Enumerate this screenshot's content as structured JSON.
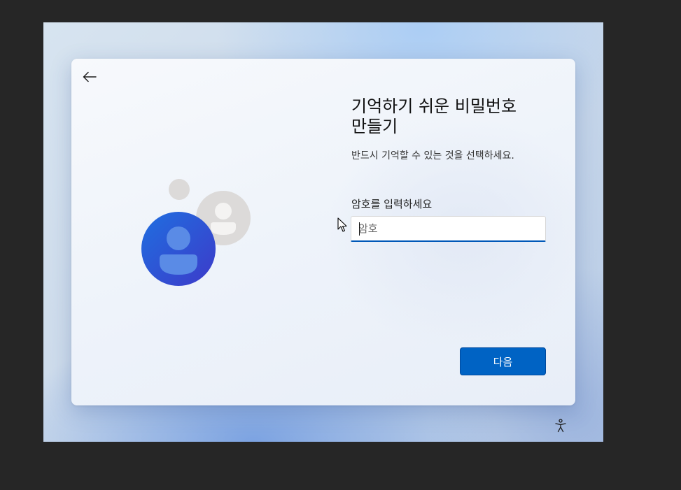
{
  "setup": {
    "title_line1": "기억하기 쉬운 비밀번호",
    "title_line2": "만들기",
    "subtitle": "반드시 기억할 수 있는 것을 선택하세요.",
    "password_field": {
      "label": "암호를 입력하세요",
      "placeholder": "암호",
      "value": ""
    },
    "next_label": "다음"
  },
  "icons": {
    "back": "back-arrow-icon",
    "illustration": "user-accounts-illustration",
    "accessibility": "accessibility-icon",
    "cursor": "mouse-pointer-icon"
  },
  "colors": {
    "accent": "#0063c4",
    "avatar_primary": "#2457d6",
    "avatar_secondary": "#dcdad9"
  }
}
